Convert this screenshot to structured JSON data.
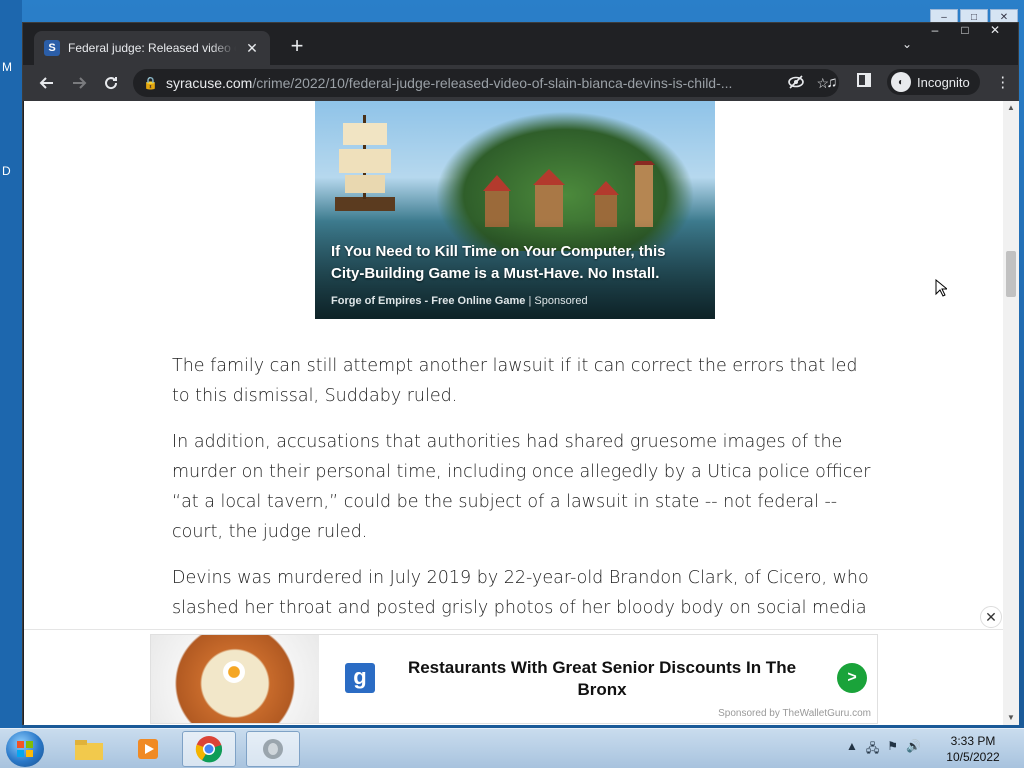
{
  "desktop": {
    "left_glyphs": [
      "M",
      "D"
    ]
  },
  "browser": {
    "tab": {
      "title": "Federal judge: Released video of slain Bianca Devins is child",
      "favicon": "S"
    },
    "address": {
      "host": "syracuse.com",
      "path": "/crime/2022/10/federal-judge-released-video-of-slain-bianca-devins-is-child-...",
      "security_icon": "lock-icon"
    },
    "profile": {
      "label": "Incognito"
    },
    "icons": {
      "back": "arrow-left-icon",
      "forward": "arrow-right-icon",
      "reload": "reload-icon",
      "eye_off": "eye-off-icon",
      "star": "star-icon",
      "media": "media-queue-icon",
      "side_panel": "side-panel-icon",
      "menu": "kebab-menu-icon"
    }
  },
  "ad_top": {
    "headline": "If You Need to Kill Time on Your Computer, this City-Building Game is a Must-Have. No Install.",
    "advertiser": "Forge of Empires - Free Online Game",
    "separator": "|",
    "sponsored": "Sponsored"
  },
  "article": {
    "paragraphs": [
      "The family can still attempt another lawsuit if it can correct the errors that led to this dismissal, Suddaby ruled.",
      "In addition, accusations that authorities had shared gruesome images of the murder on their personal time, including once allegedly by a Utica police officer “at a local tavern,” could be the subject of a lawsuit in state -- not federal -- court, the judge ruled.",
      "Devins was murdered in July 2019 by 22-year-old Brandon Clark, of Cicero, who slashed her throat and posted grisly photos of her bloody body on social media"
    ]
  },
  "ad_bottom": {
    "headline": "Restaurants With Great Senior Discounts In The Bronx",
    "sponsor_line": "Sponsored by TheWalletGuru.com",
    "logo_letter": "g",
    "go_glyph": ">"
  },
  "taskbar": {
    "time": "3:33 PM",
    "date": "10/5/2022"
  }
}
